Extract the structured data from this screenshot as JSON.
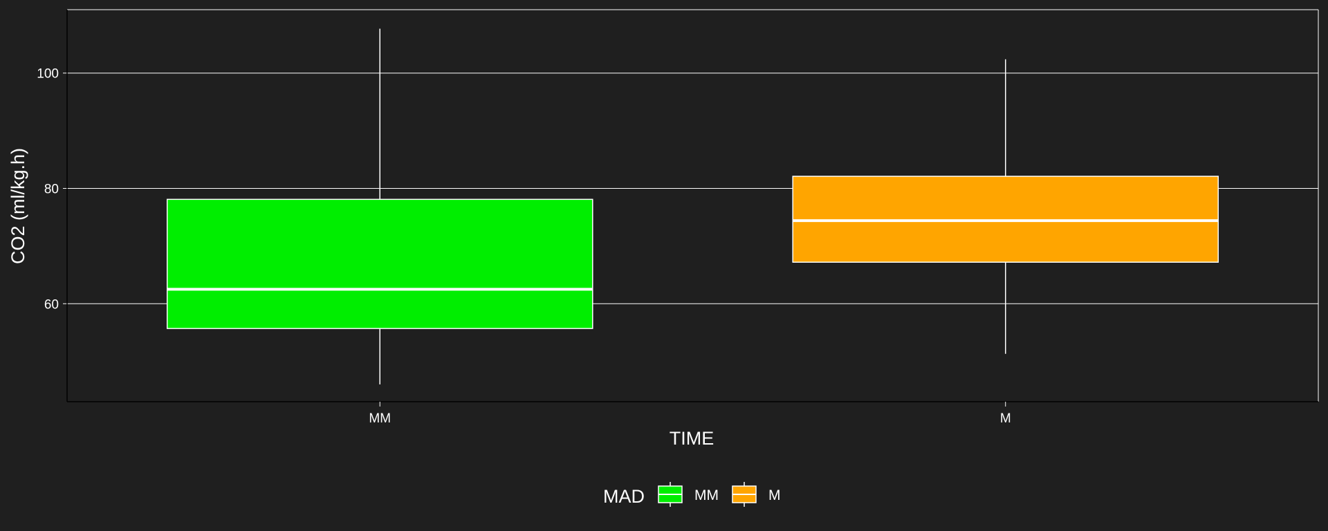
{
  "chart_data": {
    "type": "boxplot",
    "xlabel": "TIME",
    "ylabel": "CO2 (ml/kg.h)",
    "categories": [
      "MM",
      "M"
    ],
    "ylim": [
      43.0,
      111.0
    ],
    "yticks": [
      60,
      80,
      100
    ],
    "grid": true,
    "series": [
      {
        "category": "MM",
        "min": 46.0,
        "q1": 55.7,
        "median": 62.5,
        "q3": 78.1,
        "max": 107.7,
        "color": "#00ee00"
      },
      {
        "category": "M",
        "min": 51.3,
        "q1": 67.2,
        "median": 74.4,
        "q3": 82.1,
        "max": 102.4,
        "color": "#ffa500"
      }
    ],
    "legend": {
      "title": "MAD",
      "position": "bottom",
      "items": [
        {
          "label": "MM",
          "color": "#00ee00"
        },
        {
          "label": "M",
          "color": "#ffa500"
        }
      ]
    },
    "colors": {
      "background": "#1f1f1f",
      "grid": "#ffffff",
      "box_outline": "#ffffff"
    }
  }
}
